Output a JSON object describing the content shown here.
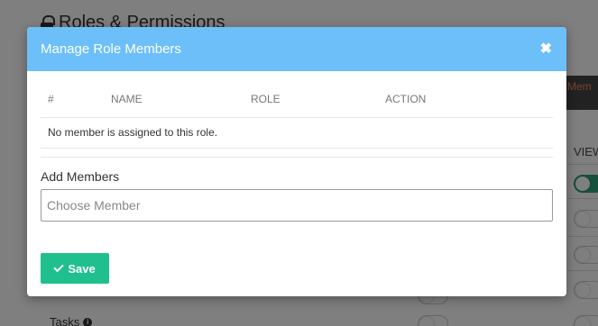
{
  "background": {
    "page_title": "Roles & Permissions",
    "members_button_label": "Mem",
    "view_column_label": "VIEW",
    "tasks_label": "Tasks",
    "info_icon": "info-icon"
  },
  "modal": {
    "title": "Manage Role Members",
    "close_icon": "close-icon",
    "table": {
      "headers": [
        "#",
        "NAME",
        "ROLE",
        "ACTION"
      ],
      "empty_message": "No member is assigned to this role."
    },
    "add_members_label": "Add Members",
    "member_input": {
      "placeholder": "Choose Member",
      "value": ""
    },
    "save_button": {
      "label": "Save",
      "icon": "check-icon"
    }
  },
  "colors": {
    "header_bg": "#6cbff9",
    "save_bg": "#1fc08e",
    "toggle_on": "#2ea37a"
  }
}
